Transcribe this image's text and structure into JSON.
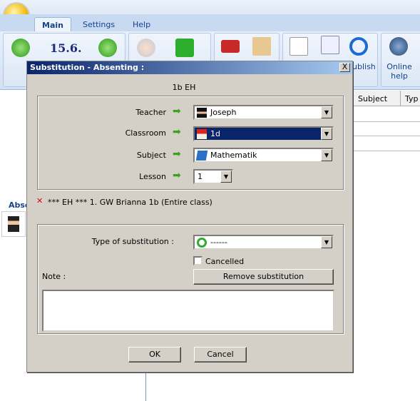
{
  "app": {
    "tabs": [
      "Main",
      "Settings",
      "Help"
    ],
    "date": "15.6.",
    "publish_label": "ublish",
    "online_help_label": "Online help",
    "left_label": "Abse",
    "grid_headers": [
      "Subject",
      "Typ"
    ]
  },
  "dialog": {
    "title": "Substitution - Absenting :",
    "close": "X",
    "header": "1b EH",
    "fields": {
      "teacher_label": "Teacher",
      "teacher": "Joseph",
      "classroom_label": "Classroom",
      "classroom": "1d",
      "subject_label": "Subject",
      "subject": "Mathematik",
      "lesson_label": "Lesson",
      "lesson": "1"
    },
    "lesson_info": "*** EH *** 1. GW Brianna 1b (Entire class)",
    "type_label": "Type of substitution :",
    "type_value": "------",
    "cancelled_label": "Cancelled",
    "cancelled": false,
    "remove_label": "Remove substitution",
    "note_label": "Note :",
    "note_value": "",
    "ok": "OK",
    "cancel": "Cancel"
  },
  "colors": {
    "title_bar": "#0a246a",
    "selected": "#0a246a",
    "dialog_bg": "#d4d0c8"
  }
}
